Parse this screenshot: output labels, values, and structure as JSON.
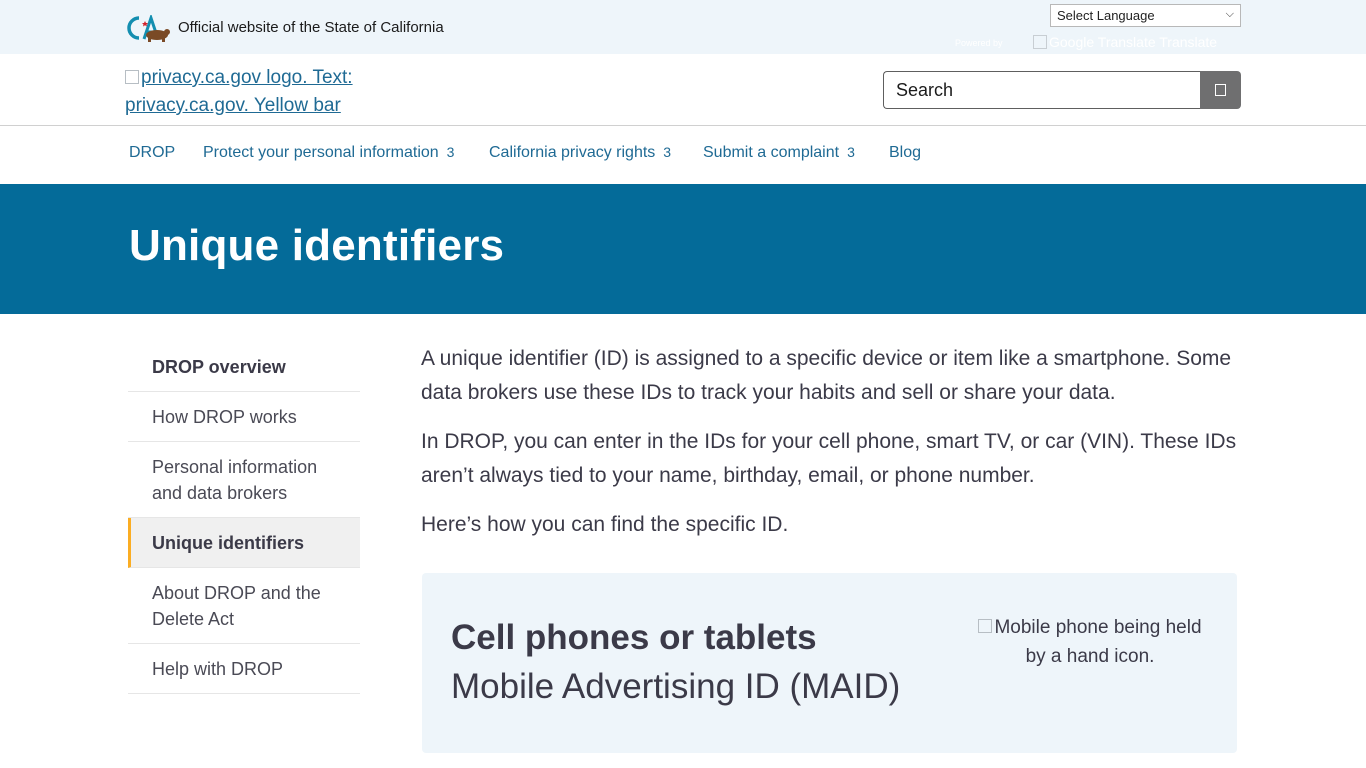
{
  "utility": {
    "official_text": "Official website of the State of California",
    "language_select": "Select Language",
    "powered_by": "Powered by",
    "google_translate_alt": "Google Translate Translate"
  },
  "brand": {
    "logo_alt": "privacy.ca.gov logo. Text: privacy.ca.gov. Yellow bar"
  },
  "search": {
    "placeholder": "Search"
  },
  "nav": {
    "items": [
      {
        "label": "DROP",
        "chevron": ""
      },
      {
        "label": "Protect your personal information",
        "chevron": "3"
      },
      {
        "label": "California privacy rights",
        "chevron": "3"
      },
      {
        "label": "Submit a complaint",
        "chevron": "3"
      },
      {
        "label": "Blog",
        "chevron": ""
      }
    ]
  },
  "page": {
    "title": "Unique identifiers"
  },
  "sidebar": {
    "items": [
      {
        "label": "DROP overview"
      },
      {
        "label": "How DROP works"
      },
      {
        "label": "Personal information and data brokers"
      },
      {
        "label": "Unique identifiers"
      },
      {
        "label": "About DROP and the Delete Act"
      },
      {
        "label": "Help with DROP"
      }
    ]
  },
  "content": {
    "paragraphs": [
      "A unique identifier (ID) is assigned to a specific device or item like a smartphone. Some data brokers use these IDs to track your habits and sell or share your data.",
      "In DROP, you can enter in the IDs for your cell phone, smart TV, or car (VIN). These IDs aren’t always tied to your name, birthday, email, or phone number.",
      "Here’s how you can find the specific ID."
    ]
  },
  "card": {
    "title": "Cell phones or tablets",
    "subtitle": "Mobile Advertising ID (MAID)",
    "image_alt": "Mobile phone being held by a hand icon."
  },
  "colors": {
    "banner": "#046b99",
    "utility_bg": "#eef5fa",
    "link": "#1f6a94",
    "active_marker": "#fbad23"
  }
}
